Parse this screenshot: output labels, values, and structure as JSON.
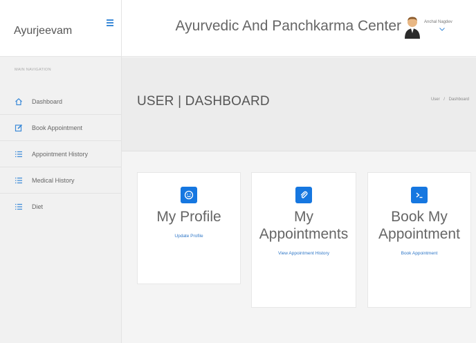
{
  "brand": {
    "name": "Ayurjeevam"
  },
  "header": {
    "center_title": "Ayurvedic And Panchkarma Center",
    "user_name": "Anchal Nagdev"
  },
  "sidebar": {
    "heading": "Main Navigation",
    "items": [
      {
        "label": "Dashboard",
        "icon": "home-icon"
      },
      {
        "label": "Book Appointment",
        "icon": "edit-icon"
      },
      {
        "label": "Appointment History",
        "icon": "list-icon"
      },
      {
        "label": "Medical History",
        "icon": "list-icon"
      },
      {
        "label": "Diet",
        "icon": "list-icon"
      }
    ]
  },
  "page": {
    "title": "USER | DASHBOARD",
    "breadcrumb": [
      "User",
      "Dashboard"
    ]
  },
  "cards": [
    {
      "title_line1": "My Profile",
      "title_line2": "",
      "link": "Update Profile",
      "icon": "smiley-icon"
    },
    {
      "title_line1": "My",
      "title_line2": "Appointments",
      "link": "View Appointment History",
      "icon": "paperclip-icon"
    },
    {
      "title_line1": "Book My",
      "title_line2": "Appointment",
      "link": "Book Appointment",
      "icon": "terminal-icon"
    }
  ],
  "colors": {
    "accent": "#1677e0",
    "link": "#2f77c7",
    "sidebar_bg": "#f1f1f1",
    "page_bg": "#f4f4f4"
  }
}
